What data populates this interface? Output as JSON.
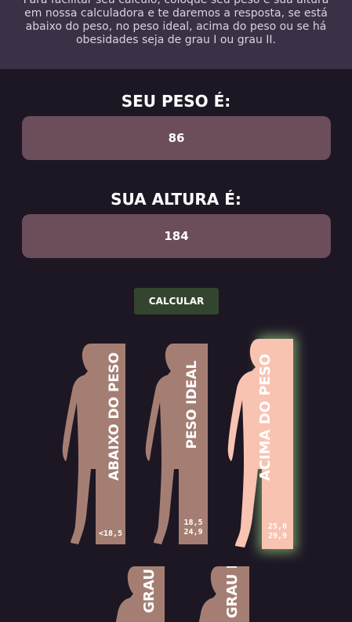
{
  "intro": {
    "text": "Para facilitar seu cálculo, coloque seu peso e sua altura em nossa calculadora e te daremos a resposta, se está abaixo do peso, no peso ideal, acima do peso ou se há obesidades seja de grau I ou grau II."
  },
  "form": {
    "weight_label": "SEU PESO É:",
    "weight_value": "86",
    "height_label": "SUA ALTURA É:",
    "height_value": "184",
    "calculate_label": "CALCULAR"
  },
  "categories": [
    {
      "label": "ABAIXO DO PESO",
      "range_line1": "<18,5",
      "range_line2": "",
      "highlighted": false
    },
    {
      "label": "PESO IDEAL",
      "range_line1": "18,5",
      "range_line2": "24,9",
      "highlighted": false
    },
    {
      "label": "ACIMA DO PESO",
      "range_line1": "25,0",
      "range_line2": "29,9",
      "highlighted": true
    },
    {
      "label": "GRAU I",
      "range_line1": "",
      "range_line2": "",
      "highlighted": false
    },
    {
      "label": "GRAU II",
      "range_line1": "",
      "range_line2": "",
      "highlighted": false
    }
  ],
  "colors": {
    "background": "#1d1724",
    "intro_background": "#3b3147",
    "input_background": "#6b4d5c",
    "button_background": "#34452f",
    "card_normal": "#a57e73",
    "card_highlight": "#f8c3b1",
    "glow": "#8fc37a"
  }
}
